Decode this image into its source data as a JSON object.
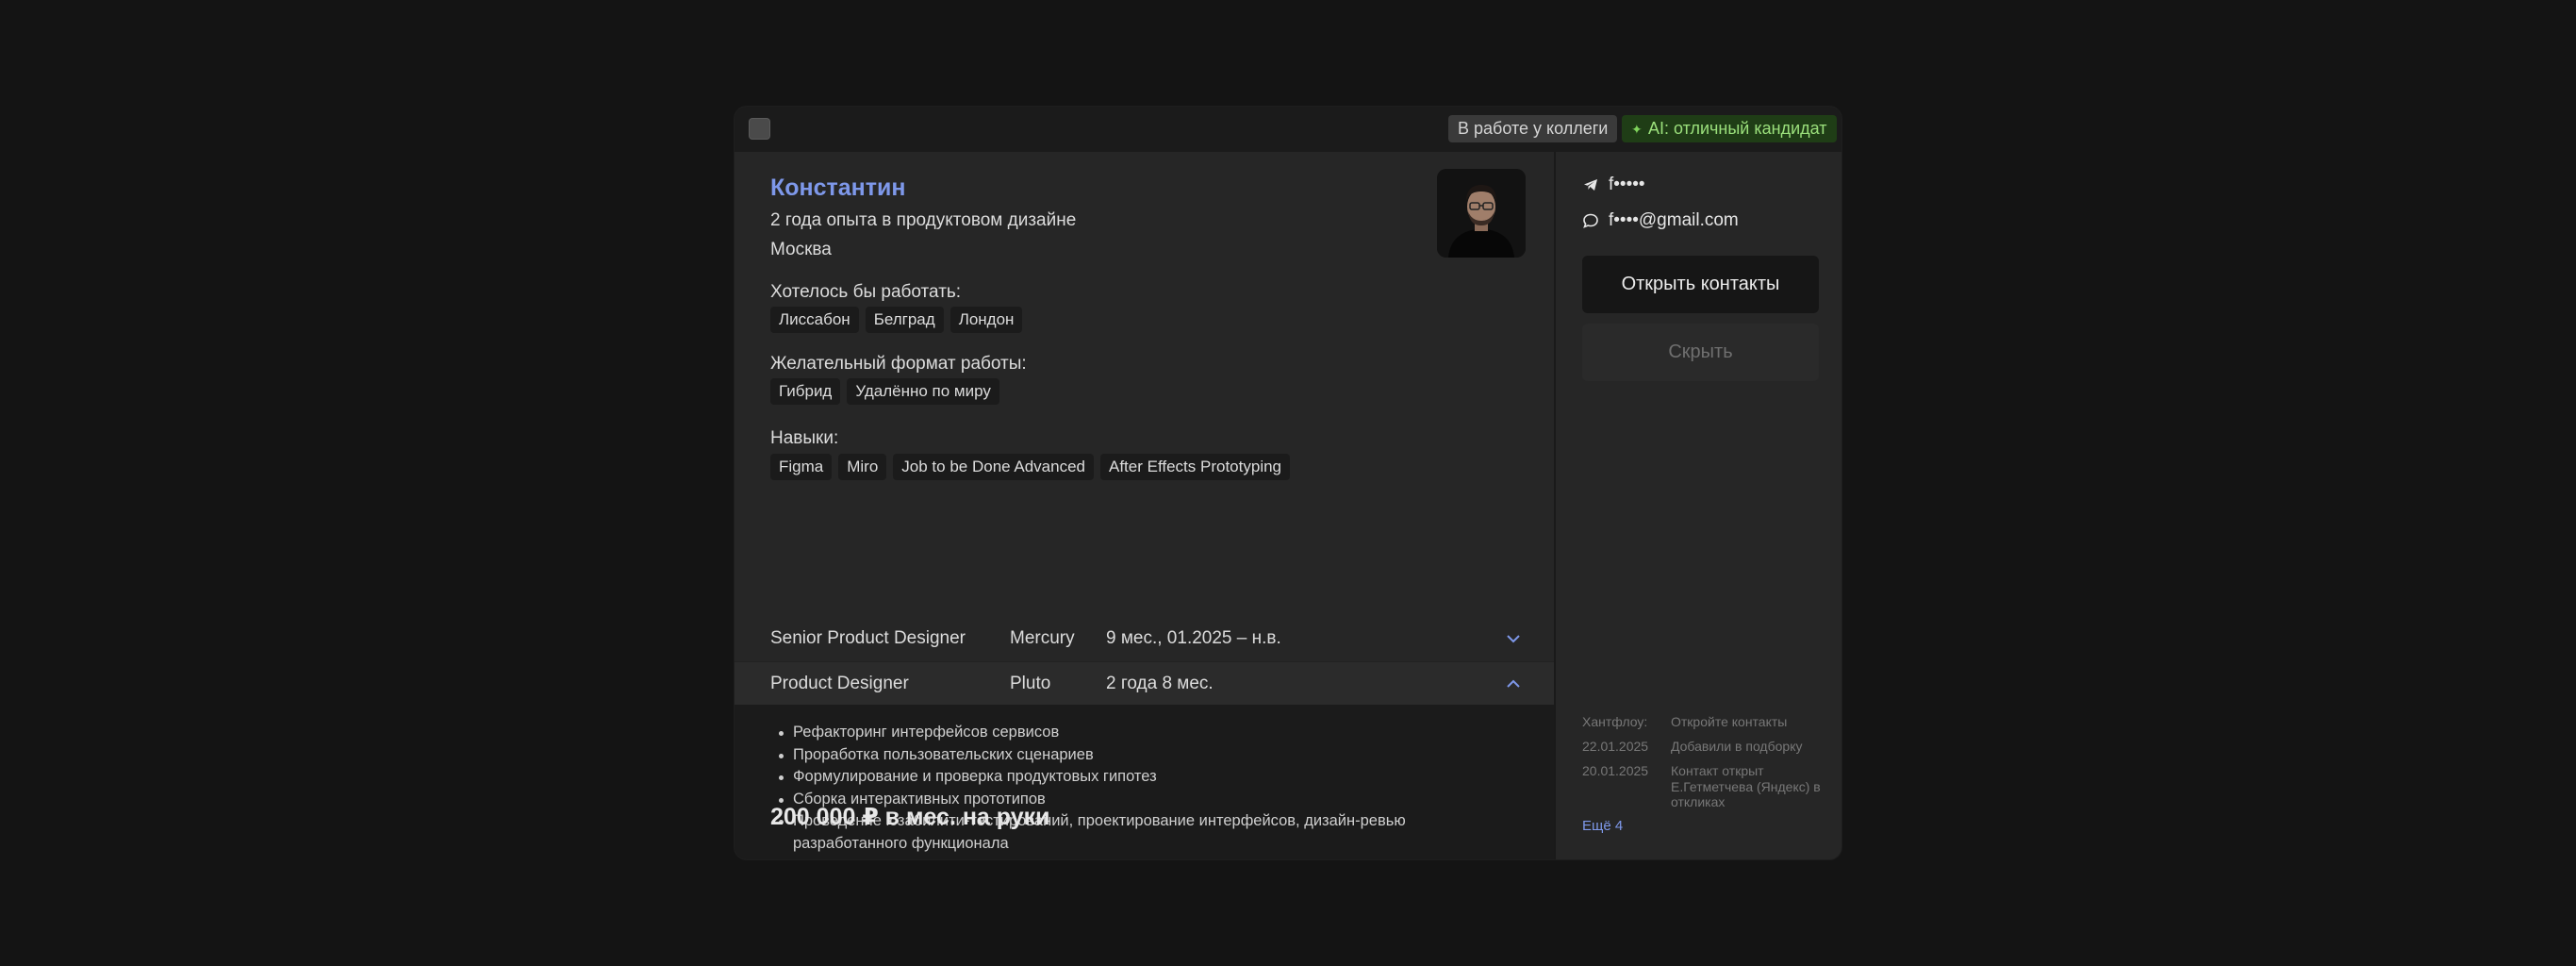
{
  "header": {
    "badge_colleague": "В работе у коллеги",
    "badge_ai": "AI: отличный кандидат",
    "colors": {
      "ai_badge_bg": "#1f3d16",
      "ai_badge_text": "#9be07c",
      "accent": "#7e98ea"
    }
  },
  "candidate": {
    "name": "Константин",
    "experience": "2 года опыта в продуктовом дизайне",
    "city": "Москва",
    "avatar_icon": "person-photo"
  },
  "wish_cities": {
    "label": "Хотелось бы работать:",
    "items": [
      "Лиссабон",
      "Белград",
      "Лондон"
    ]
  },
  "work_format": {
    "label": "Желательный формат работы:",
    "items": [
      "Гибрид",
      "Удалённо по миру"
    ]
  },
  "skills": {
    "label": "Навыки:",
    "items": [
      "Figma",
      "Miro",
      "Job to be Done Advanced",
      "After Effects Prototyping"
    ]
  },
  "jobs": [
    {
      "title": "Senior Product Designer",
      "company": "Mercury",
      "period": "9 мес., 01.2025 – н.в.",
      "expanded": false
    },
    {
      "title": "Product Designer",
      "company": "Pluto",
      "period": "2 года 8 мес.",
      "expanded": true
    }
  ],
  "duties": [
    "Рефакторинг интерфейсов сервисов",
    "Проработка пользовательских сценариев",
    "Формулирование и проверка продуктовых гипотез",
    "Сборка интерактивных прототипов",
    "Проведение юзабилити-тестирований, проектирование интерфейсов, дизайн-ревью разработанного функционала"
  ],
  "salary": "200 000 ₽ в мес. на руки",
  "sidebar": {
    "telegram": "f•••••",
    "email": "f••••@gmail.com",
    "open_contacts": "Открыть контакты",
    "hide": "Скрыть",
    "history": [
      {
        "date": "Хантфлоу:",
        "text": "Откройте контакты"
      },
      {
        "date": "22.01.2025",
        "text": "Добавили в подборку"
      },
      {
        "date": "20.01.2025",
        "text": "Контакт открыт Е.Гетметчева (Яндекс) в откликах"
      }
    ],
    "more": "Ещё 4"
  }
}
